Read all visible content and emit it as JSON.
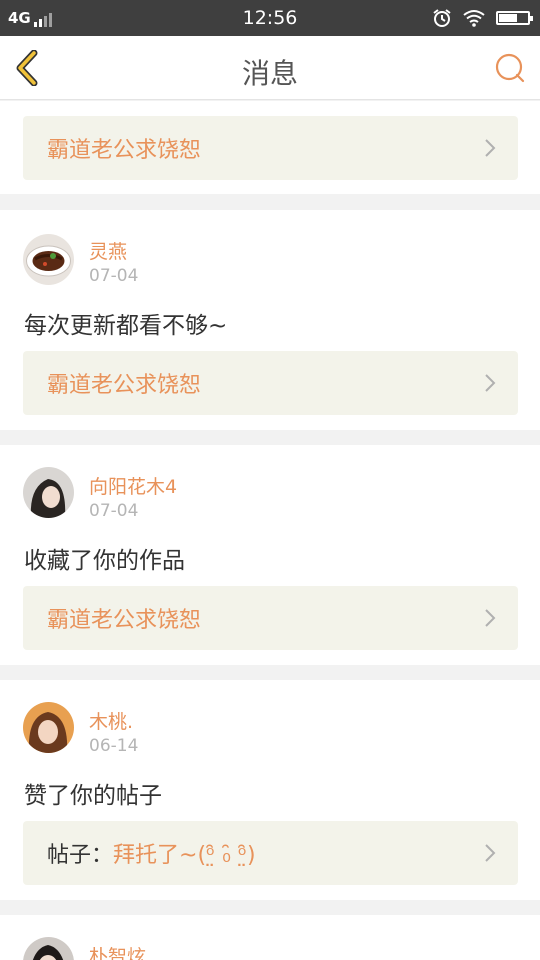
{
  "status_bar": {
    "network": "4G",
    "time": "12:56"
  },
  "header": {
    "title": "消息"
  },
  "messages": [
    {
      "box_text": "霸道老公求饶恕"
    },
    {
      "user": "灵燕",
      "date": "07-04",
      "action": "每次更新都看不够~",
      "box_text": "霸道老公求饶恕"
    },
    {
      "user": "向阳花木4",
      "date": "07-04",
      "action": "收藏了你的作品",
      "box_text": "霸道老公求饶恕"
    },
    {
      "user": "木桃.",
      "date": "06-14",
      "action": "赞了你的帖子",
      "box_prefix": "帖子：",
      "box_text": "拜托了~(ᵒ̤̑ ₀̑ ᵒ̤̑)"
    },
    {
      "user": "朴智炫"
    }
  ],
  "colors": {
    "accent": "#e8925a",
    "box_bg": "#f3f3ea",
    "status_bg": "#3f3f3f"
  }
}
